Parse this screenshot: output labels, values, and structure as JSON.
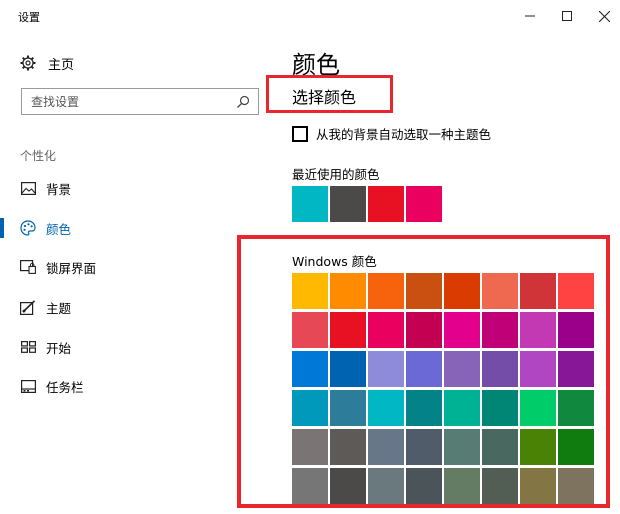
{
  "window": {
    "title": "设置"
  },
  "nav": {
    "home": "主页",
    "search_placeholder": "查找设置",
    "section": "个性化",
    "items": [
      {
        "label": "背景",
        "icon": "picture-icon"
      },
      {
        "label": "颜色",
        "icon": "palette-icon",
        "active": true
      },
      {
        "label": "锁屏界面",
        "icon": "lock-screen-icon"
      },
      {
        "label": "主题",
        "icon": "theme-brush-icon"
      },
      {
        "label": "开始",
        "icon": "start-grid-icon"
      },
      {
        "label": "任务栏",
        "icon": "taskbar-icon"
      }
    ]
  },
  "main": {
    "title": "颜色",
    "subtitle": "选择颜色",
    "auto_pick_label": "从我的背景自动选取一种主题色",
    "auto_pick_checked": false,
    "recent_label": "最近使用的颜色",
    "recent_colors": [
      "#00B7C3",
      "#4C4A48",
      "#E81123",
      "#EA005E"
    ],
    "windows_colors_label": "Windows 颜色",
    "windows_colors": [
      [
        "#FFB900",
        "#FF8C00",
        "#F7630C",
        "#CA5010",
        "#DA3B01",
        "#EF6950",
        "#D13438",
        "#FF4343"
      ],
      [
        "#E74856",
        "#E81123",
        "#EA005E",
        "#C30052",
        "#E3008C",
        "#BF0077",
        "#C239B3",
        "#9A0089"
      ],
      [
        "#0078D7",
        "#0063B1",
        "#8E8CD8",
        "#6B69D6",
        "#8764B8",
        "#744DA9",
        "#B146C2",
        "#881798"
      ],
      [
        "#0099BC",
        "#2D7D9A",
        "#00B7C3",
        "#038387",
        "#00B294",
        "#018574",
        "#00CC6A",
        "#10893E"
      ],
      [
        "#7A7574",
        "#5D5A58",
        "#68768A",
        "#515C6B",
        "#567C73",
        "#486860",
        "#498205",
        "#107C10"
      ],
      [
        "#767676",
        "#4C4A48",
        "#69797E",
        "#4A5459",
        "#647C64",
        "#525E54",
        "#847545",
        "#7E735F"
      ]
    ]
  },
  "colors": {
    "accent": "#0063b1",
    "highlight_box": "#e8262e"
  }
}
